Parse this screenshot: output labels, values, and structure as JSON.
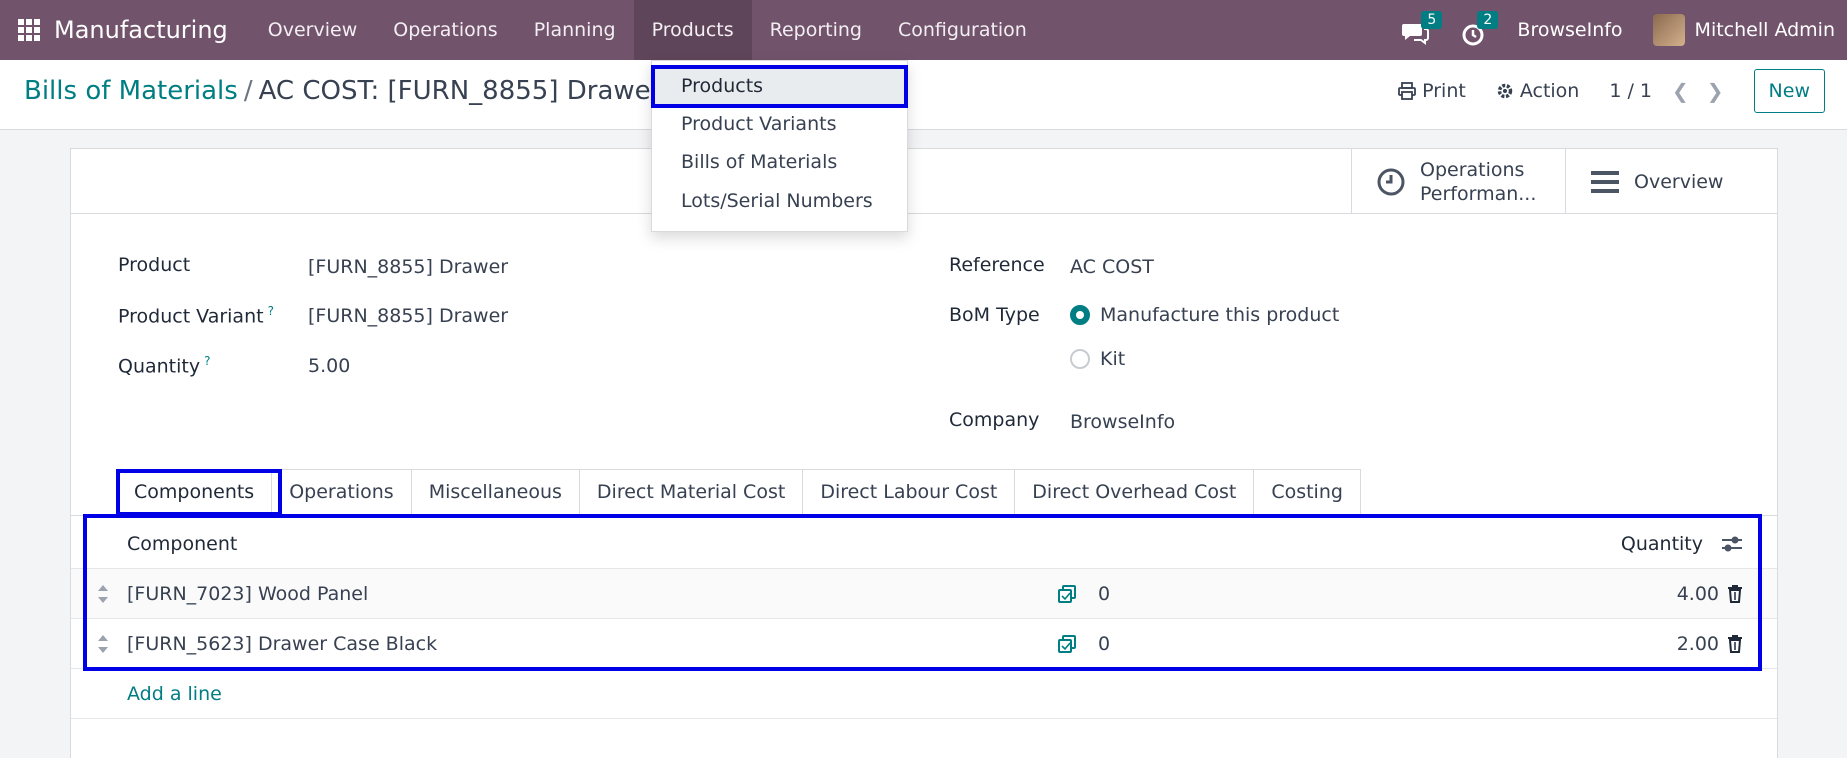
{
  "navbar": {
    "brand": "Manufacturing",
    "menu": [
      "Overview",
      "Operations",
      "Planning",
      "Products",
      "Reporting",
      "Configuration"
    ],
    "messages_count": "5",
    "activities_count": "2",
    "company": "BrowseInfo",
    "user": "Mitchell Admin"
  },
  "dropdown": {
    "items": [
      "Products",
      "Product Variants",
      "Bills of Materials",
      "Lots/Serial Numbers"
    ]
  },
  "control": {
    "breadcrumb_parent": "Bills of Materials",
    "breadcrumb_sep": "/",
    "breadcrumb_current": "AC COST: [FURN_8855] Drawer",
    "print": "Print",
    "action": "Action",
    "pager": "1 / 1",
    "new": "New"
  },
  "smart_buttons": {
    "ops_line1": "Operations",
    "ops_line2": "Performan...",
    "overview": "Overview"
  },
  "form": {
    "product_label": "Product",
    "product_value": "[FURN_8855] Drawer",
    "variant_label": "Product Variant",
    "variant_value": "[FURN_8855] Drawer",
    "quantity_label": "Quantity",
    "quantity_value": "5.00",
    "help_mark": "?",
    "reference_label": "Reference",
    "reference_value": "AC COST",
    "bom_type_label": "BoM Type",
    "bom_type_options": [
      "Manufacture this product",
      "Kit"
    ],
    "bom_type_selected": "Manufacture this product",
    "company_label": "Company",
    "company_value": "BrowseInfo"
  },
  "tabs": [
    "Components",
    "Operations",
    "Miscellaneous",
    "Direct Material Cost",
    "Direct Labour Cost",
    "Direct Overhead Cost",
    "Costing"
  ],
  "components": {
    "header_component": "Component",
    "header_quantity": "Quantity",
    "rows": [
      {
        "component": "[FURN_7023] Wood Panel",
        "mid": "0",
        "quantity": "4.00"
      },
      {
        "component": "[FURN_5623] Drawer Case Black",
        "mid": "0",
        "quantity": "2.00"
      }
    ],
    "add_line": "Add a line"
  },
  "colors": {
    "navbar": "#71536b",
    "accent": "#017e84",
    "highlight": "#0000e6"
  }
}
